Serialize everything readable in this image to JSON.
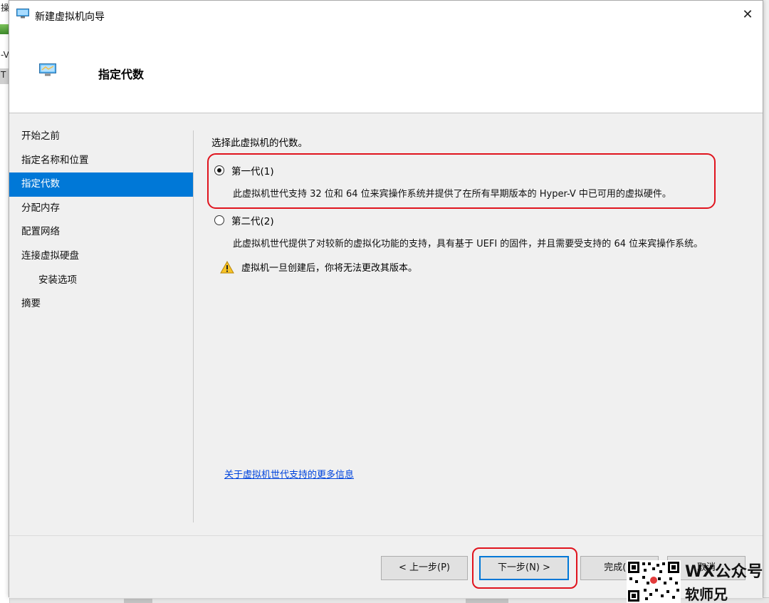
{
  "background": {
    "left_fragments": [
      "操",
      "-V",
      "T"
    ]
  },
  "window": {
    "title": "新建虚拟机向导",
    "close_glyph": "✕"
  },
  "header": {
    "title": "指定代数"
  },
  "nav": {
    "items": [
      {
        "label": "开始之前",
        "active": false,
        "sub": false
      },
      {
        "label": "指定名称和位置",
        "active": false,
        "sub": false
      },
      {
        "label": "指定代数",
        "active": true,
        "sub": false
      },
      {
        "label": "分配内存",
        "active": false,
        "sub": false
      },
      {
        "label": "配置网络",
        "active": false,
        "sub": false
      },
      {
        "label": "连接虚拟硬盘",
        "active": false,
        "sub": false
      },
      {
        "label": "安装选项",
        "active": false,
        "sub": true
      },
      {
        "label": "摘要",
        "active": false,
        "sub": false
      }
    ]
  },
  "content": {
    "prompt": "选择此虚拟机的代数。",
    "gen1": {
      "label": "第一代(1)",
      "checked": true,
      "description": "此虚拟机世代支持 32 位和 64 位来宾操作系统并提供了在所有早期版本的 Hyper-V 中已可用的虚拟硬件。"
    },
    "gen2": {
      "label": "第二代(2)",
      "checked": false,
      "description": "此虚拟机世代提供了对较新的虚拟化功能的支持，具有基于 UEFI 的固件，并且需要受支持的 64 位来宾操作系统。"
    },
    "warning": "虚拟机一旦创建后，你将无法更改其版本。",
    "more_link": "关于虚拟机世代支持的更多信息"
  },
  "footer": {
    "prev": "< 上一步(P)",
    "next": "下一步(N) >",
    "finish": "完成(F)",
    "cancel": "取消"
  },
  "watermark": {
    "line1": "WX公众号",
    "line2": "软师兄"
  },
  "colors": {
    "accent": "#0078d7",
    "highlight": "#e0141e",
    "link": "#0044dd"
  }
}
